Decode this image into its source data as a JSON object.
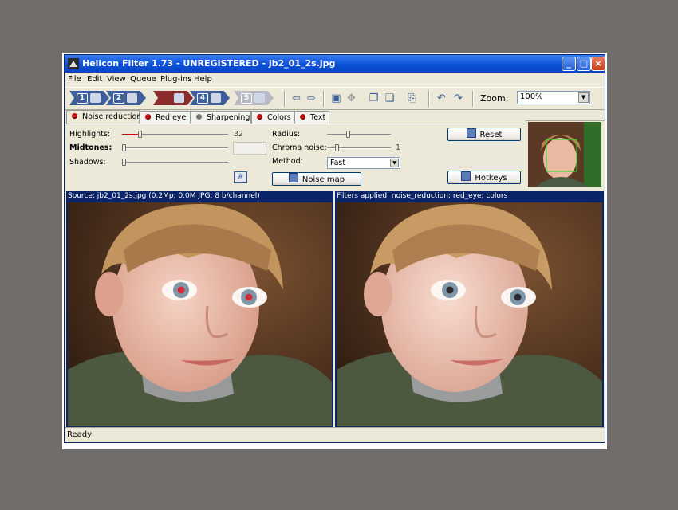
{
  "window": {
    "title": "Helicon Filter 1.73 - UNREGISTERED - jb2_01_2s.jpg",
    "minimize": "_",
    "maximize": "□",
    "close": "×"
  },
  "menu": [
    "File",
    "Edit",
    "View",
    "Queue",
    "Plug-ins",
    "Help"
  ],
  "toolbar": {
    "steps": [
      "1",
      "2",
      "3",
      "4",
      "5"
    ],
    "zoom_label": "Zoom:",
    "zoom_value": "100%"
  },
  "tabs": [
    {
      "label": "Noise reduction",
      "dot": "red"
    },
    {
      "label": "Red eye",
      "dot": "red"
    },
    {
      "label": "Sharpening",
      "dot": "gray"
    },
    {
      "label": "Colors",
      "dot": "red"
    },
    {
      "label": "Text",
      "dot": "red"
    }
  ],
  "noise": {
    "highlights_label": "Highlights:",
    "highlights_value": "32",
    "midtones_label": "Midtones:",
    "midtones_value": "0",
    "shadows_label": "Shadows:",
    "shadows_value": "0",
    "radius_label": "Radius:",
    "chroma_label": "Chroma noise:",
    "chroma_value": "1",
    "method_label": "Method:",
    "method_value": "Fast",
    "noise_map_label": "Noise map",
    "reset_label": "Reset",
    "hotkeys_label": "Hotkeys"
  },
  "panes": {
    "source_header": "Source: jb2_01_2s.jpg (0.2Mp; 0.0M JPG; 8 b/channel)",
    "result_header": "Filters applied: noise_reduction; red_eye; colors"
  },
  "status": "Ready",
  "colors": {
    "title_bar": "#0a52d8",
    "pane_header": "#0a246a",
    "red_dot": "#c81414"
  }
}
